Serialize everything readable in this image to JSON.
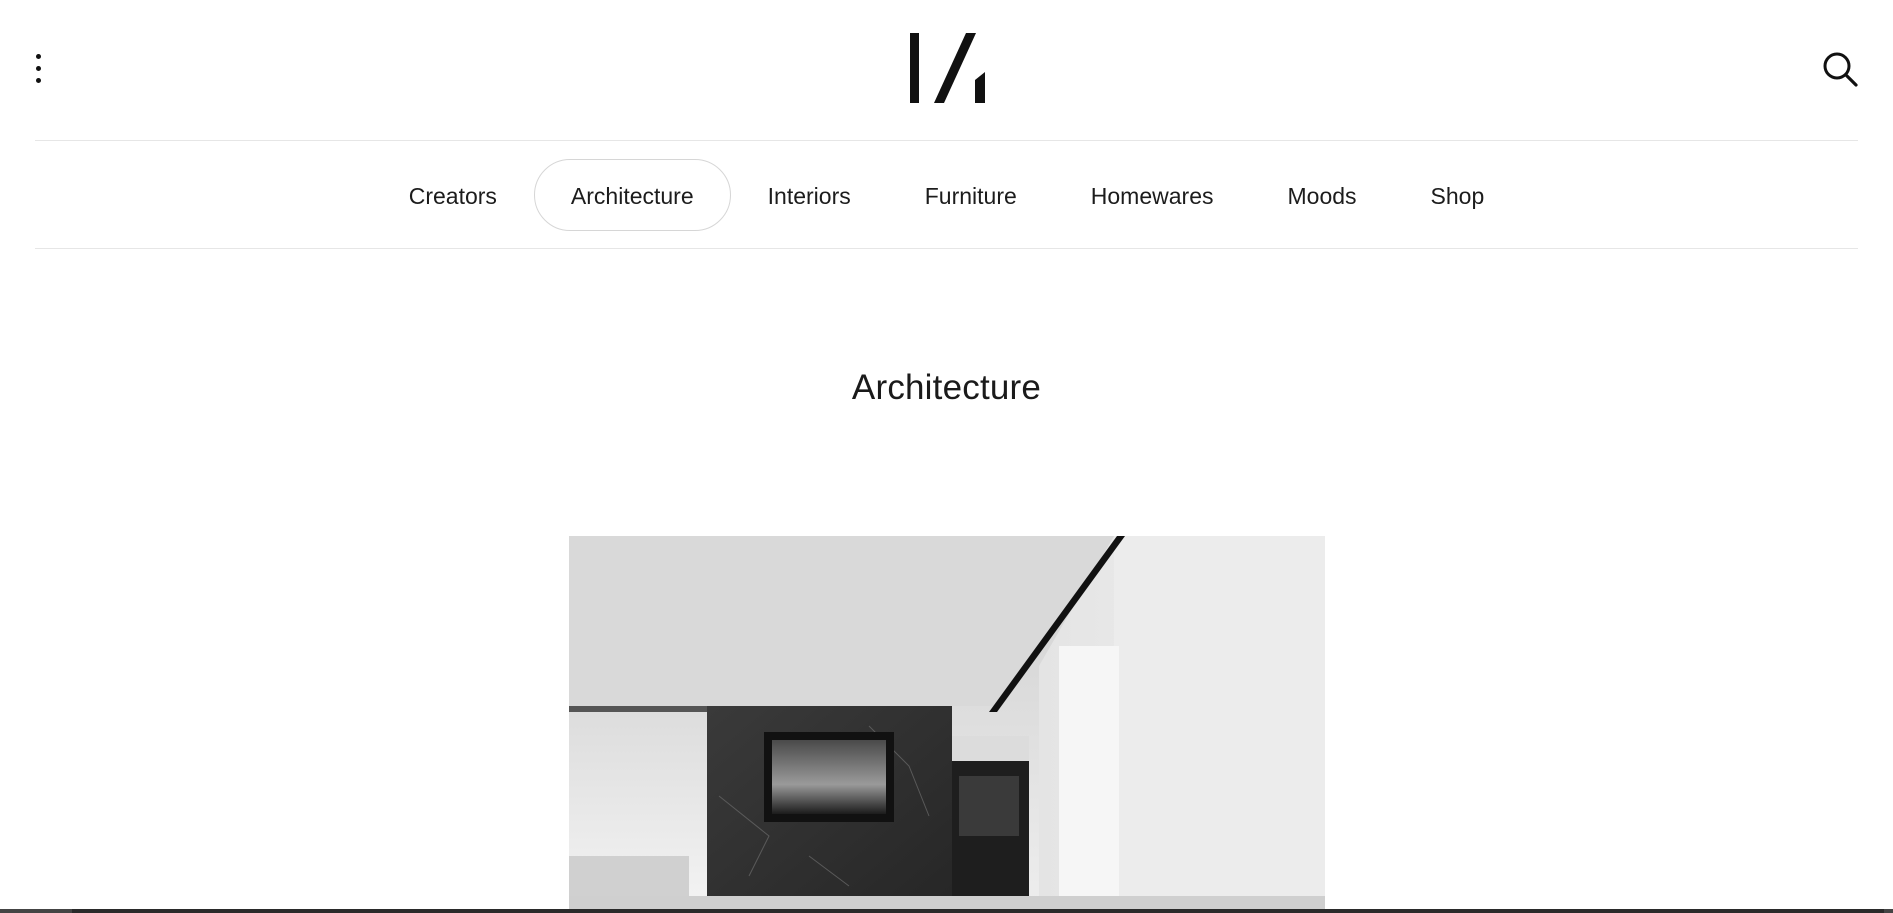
{
  "header": {
    "menu_icon": "more-vertical-icon",
    "logo_name": "brand-logo",
    "search_icon": "search-icon"
  },
  "nav": {
    "items": [
      {
        "label": "Creators",
        "active": false
      },
      {
        "label": "Architecture",
        "active": true
      },
      {
        "label": "Interiors",
        "active": false
      },
      {
        "label": "Furniture",
        "active": false
      },
      {
        "label": "Homewares",
        "active": false
      },
      {
        "label": "Moods",
        "active": false
      },
      {
        "label": "Shop",
        "active": false
      }
    ]
  },
  "main": {
    "title": "Architecture"
  },
  "colors": {
    "text": "#1a1a1a",
    "divider": "#e6e6e6",
    "active_border": "#d6d6d6",
    "background": "#ffffff"
  }
}
